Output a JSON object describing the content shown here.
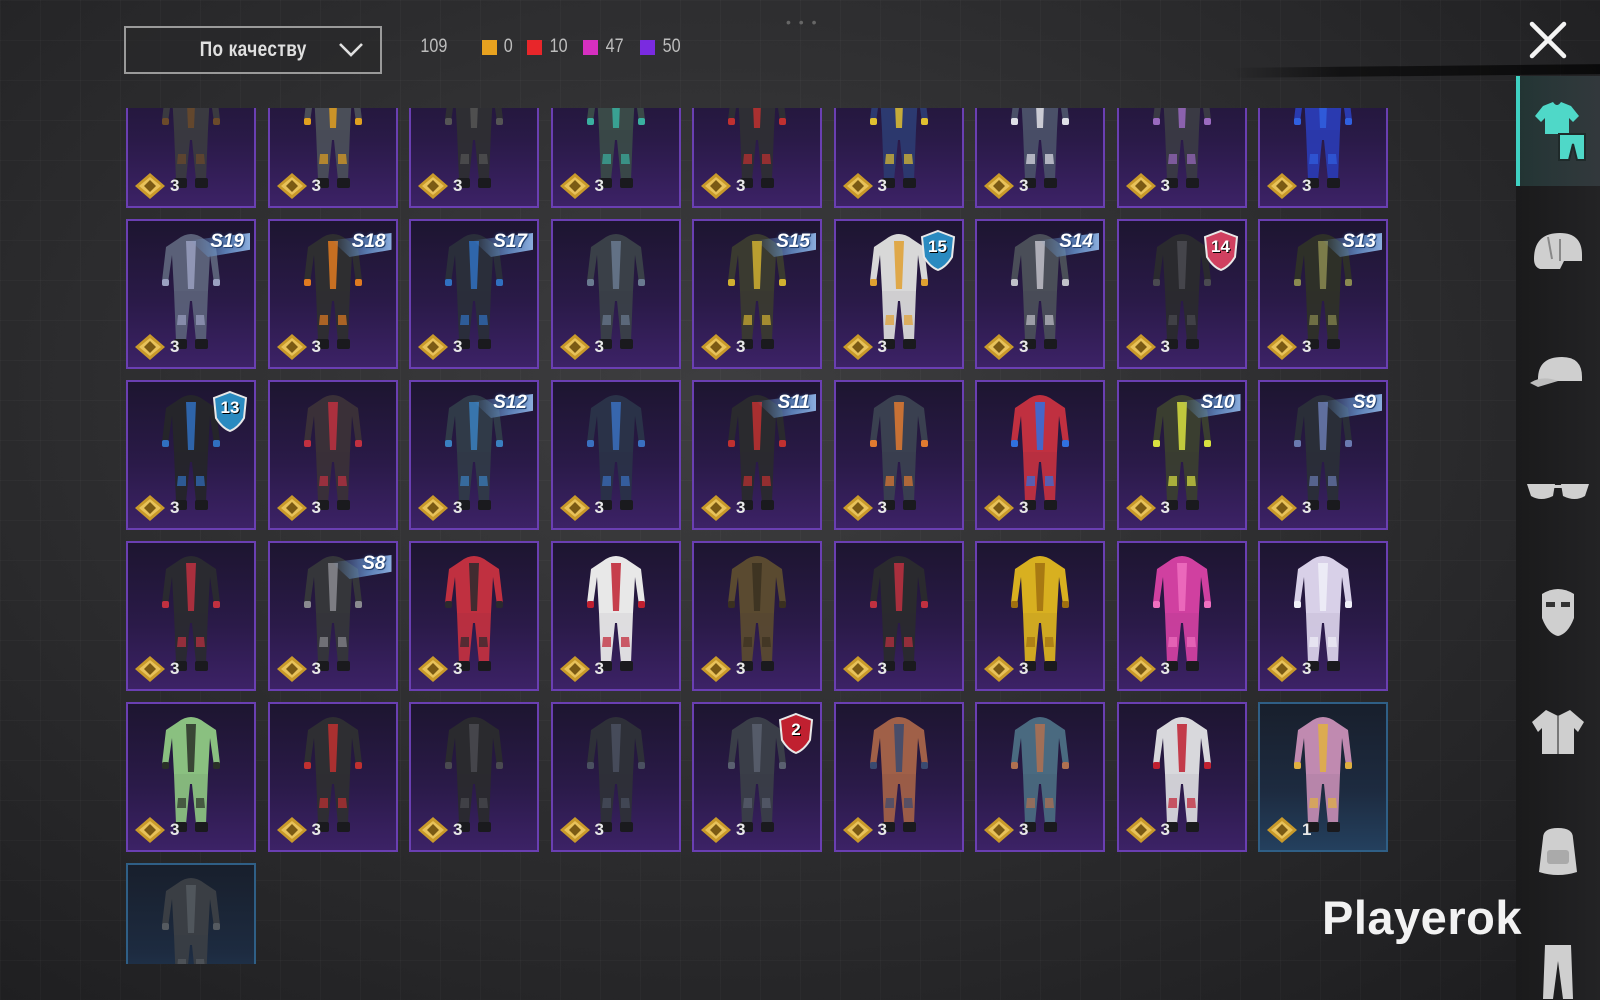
{
  "header": {
    "sort_label": "По качеству",
    "total_count": "109",
    "rarity_counts": [
      {
        "name": "legendary",
        "color": "#e8a21f",
        "value": "0"
      },
      {
        "name": "mythic",
        "color": "#e8262a",
        "value": "10"
      },
      {
        "name": "epic",
        "color": "#d62fc0",
        "value": "47"
      },
      {
        "name": "rare",
        "color": "#7a2be0",
        "value": "50"
      }
    ]
  },
  "sidebar": {
    "tabs": [
      {
        "name": "outfit",
        "icon": "shirt-pants-icon",
        "active": true
      },
      {
        "name": "helmet",
        "icon": "helmet-icon",
        "active": false
      },
      {
        "name": "hat",
        "icon": "cap-icon",
        "active": false
      },
      {
        "name": "glasses",
        "icon": "glasses-icon",
        "active": false
      },
      {
        "name": "mask",
        "icon": "mask-icon",
        "active": false
      },
      {
        "name": "jacket",
        "icon": "jacket-icon",
        "active": false
      },
      {
        "name": "backpack",
        "icon": "backpack-icon",
        "active": false
      },
      {
        "name": "pants",
        "icon": "pants-icon",
        "active": false
      }
    ]
  },
  "items": [
    {
      "qty": "3",
      "outfit": "#3a3a40",
      "accent": "#6b4a2a"
    },
    {
      "qty": "3",
      "outfit": "#4a4e58",
      "accent": "#e0a020"
    },
    {
      "qty": "3",
      "outfit": "#2e2e33",
      "accent": "#555"
    },
    {
      "qty": "3",
      "outfit": "#3a4a48",
      "accent": "#3ab0a0"
    },
    {
      "qty": "3",
      "outfit": "#2e2e34",
      "accent": "#c03030"
    },
    {
      "qty": "3",
      "outfit": "#2c3a70",
      "accent": "#e0c030"
    },
    {
      "qty": "3",
      "outfit": "#4a5068",
      "accent": "#e0e0e8"
    },
    {
      "qty": "3",
      "outfit": "#3a3a44",
      "accent": "#9a6ac0"
    },
    {
      "qty": "3",
      "outfit": "#2a3ab0",
      "accent": "#3060e0"
    },
    {
      "qty": "3",
      "outfit": "#5a6078",
      "accent": "#9aa0c0",
      "season": "S19"
    },
    {
      "qty": "3",
      "outfit": "#2e2e30",
      "accent": "#e07a20",
      "season": "S18"
    },
    {
      "qty": "3",
      "outfit": "#2a2e3a",
      "accent": "#3070c0",
      "season": "S17"
    },
    {
      "qty": "3",
      "outfit": "#3a4048",
      "accent": "#6a7a90"
    },
    {
      "qty": "3",
      "outfit": "#3a3a30",
      "accent": "#d0b030",
      "season": "S15"
    },
    {
      "qty": "3",
      "outfit": "#d8d8d8",
      "accent": "#e0a030",
      "shield": "15",
      "shieldColor": "#2a8ac0"
    },
    {
      "qty": "3",
      "outfit": "#4a4e58",
      "accent": "#c0c0c8",
      "season": "S14"
    },
    {
      "qty": "3",
      "outfit": "#2a2a2e",
      "accent": "#4a4a50",
      "shield": "14",
      "shieldColor": "#d04060"
    },
    {
      "qty": "3",
      "outfit": "#2e3028",
      "accent": "#8a8a50",
      "season": "S13"
    },
    {
      "qty": "3",
      "outfit": "#25252a",
      "accent": "#3070c0",
      "shield": "13",
      "shieldColor": "#2a8ac0"
    },
    {
      "qty": "3",
      "outfit": "#3a3038",
      "accent": "#c03040"
    },
    {
      "qty": "3",
      "outfit": "#303a48",
      "accent": "#3a80c0",
      "season": "S12"
    },
    {
      "qty": "3",
      "outfit": "#2a3248",
      "accent": "#3a70c0"
    },
    {
      "qty": "3",
      "outfit": "#2a2a2e",
      "accent": "#c03030",
      "season": "S11"
    },
    {
      "qty": "3",
      "outfit": "#3a4050",
      "accent": "#e07a30"
    },
    {
      "qty": "3",
      "outfit": "#c03040",
      "accent": "#3070e0"
    },
    {
      "qty": "3",
      "outfit": "#3a3e30",
      "accent": "#d8e040",
      "season": "S10"
    },
    {
      "qty": "3",
      "outfit": "#2a2e38",
      "accent": "#6a7ab0",
      "season": "S9"
    },
    {
      "qty": "3",
      "outfit": "#2a2a30",
      "accent": "#c03040"
    },
    {
      "qty": "3",
      "outfit": "#35363a",
      "accent": "#8a8a90",
      "season": "S8"
    },
    {
      "qty": "3",
      "outfit": "#c03040",
      "accent": "#2a2a2e"
    },
    {
      "qty": "3",
      "outfit": "#e8e8e8",
      "accent": "#c02030"
    },
    {
      "qty": "3",
      "outfit": "#5a4a30",
      "accent": "#3a3020"
    },
    {
      "qty": "3",
      "outfit": "#2a2a2e",
      "accent": "#c03040"
    },
    {
      "qty": "3",
      "outfit": "#d8b020",
      "accent": "#a07010"
    },
    {
      "qty": "3",
      "outfit": "#d040a0",
      "accent": "#f070c0"
    },
    {
      "qty": "3",
      "outfit": "#d8d0e8",
      "accent": "#f0f0f8"
    },
    {
      "qty": "3",
      "outfit": "#8ac080",
      "accent": "#2a3028"
    },
    {
      "qty": "3",
      "outfit": "#2e2e32",
      "accent": "#c03030"
    },
    {
      "qty": "3",
      "outfit": "#2a2a2e",
      "accent": "#4a4a50"
    },
    {
      "qty": "3",
      "outfit": "#2e3038",
      "accent": "#4a5060"
    },
    {
      "qty": "3",
      "outfit": "#3a3e48",
      "accent": "#5a6070",
      "shield": "2",
      "shieldColor": "#c02030"
    },
    {
      "qty": "3",
      "outfit": "#a06048",
      "accent": "#3a4a70"
    },
    {
      "qty": "3",
      "outfit": "#4a6a80",
      "accent": "#b07050"
    },
    {
      "qty": "3",
      "outfit": "#d8d8dc",
      "accent": "#c02030"
    },
    {
      "qty": "1",
      "outfit": "#c08ab0",
      "accent": "#e0b040",
      "blue": true
    },
    {
      "qty": "",
      "outfit": "#3a3e44",
      "accent": "#555a60",
      "blue": true
    }
  ],
  "watermark": "Playerok",
  "drag_handle": "• • •"
}
